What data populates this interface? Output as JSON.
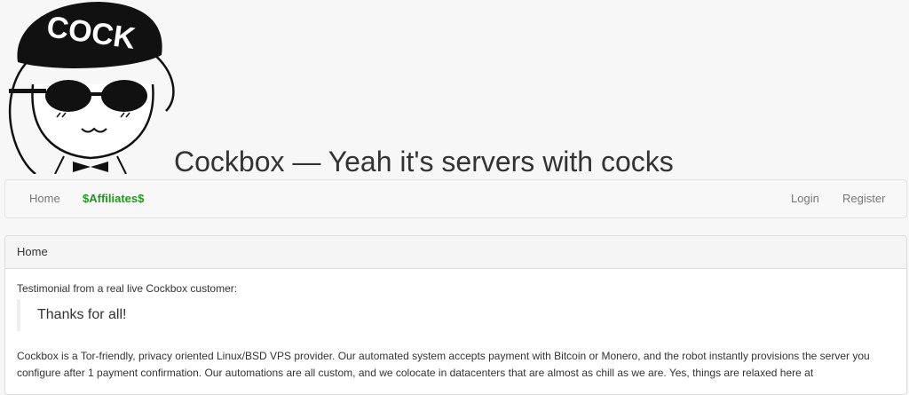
{
  "header": {
    "logo_text": "COCK",
    "title": "Cockbox — Yeah it's servers with cocks"
  },
  "nav": {
    "home": "Home",
    "affiliates": "$Affiliates$",
    "login": "Login",
    "register": "Register"
  },
  "panel": {
    "heading": "Home",
    "testimonial_label": "Testimonial from a real live Cockbox customer:",
    "quote": "Thanks for all!",
    "description": "Cockbox is a Tor-friendly, privacy oriented Linux/BSD VPS provider. Our automated system accepts payment with Bitcoin or Monero, and the robot instantly provisions the server you configure after 1 payment confirmation. Our automations are all custom, and we colocate in datacenters that are almost as chill as we are. Yes, things are relaxed here at"
  },
  "colors": {
    "affiliates": "#1a9b1a",
    "nav_text": "#777777",
    "background": "#f7f7f8"
  }
}
